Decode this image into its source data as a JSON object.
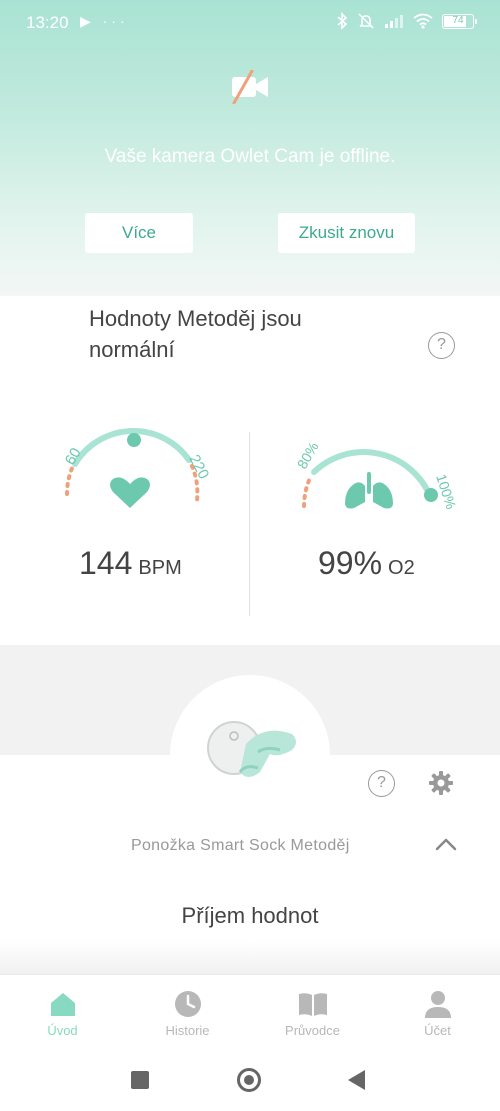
{
  "status_bar": {
    "time": "13:20",
    "left_icons": "▶ ···",
    "battery": "74"
  },
  "camera": {
    "icon": "camera-off-icon",
    "offline_message": "Vaše kamera Owlet Cam je offline.",
    "more_button": "Více",
    "retry_button": "Zkusit znovu"
  },
  "vitals": {
    "title": "Hodnoty Metoděj jsou normální",
    "heart": {
      "value": "144",
      "unit": "BPM",
      "min_label": "60",
      "max_label": "220",
      "min": 60,
      "max": 220,
      "current": 144,
      "icon": "heart-icon"
    },
    "oxygen": {
      "value": "99%",
      "unit": "O2",
      "min_label": "80%",
      "max_label": "100%",
      "min": 80,
      "max": 100,
      "current": 99,
      "icon": "lungs-icon"
    }
  },
  "sock": {
    "name": "Ponožka Smart Sock Metoděj",
    "status": "Příjem hodnot"
  },
  "nav": {
    "items": [
      {
        "label": "Úvod",
        "icon": "home-icon",
        "active": true
      },
      {
        "label": "Historie",
        "icon": "clock-icon",
        "active": false
      },
      {
        "label": "Průvodce",
        "icon": "book-icon",
        "active": false
      },
      {
        "label": "Účet",
        "icon": "person-icon",
        "active": false
      }
    ]
  },
  "colors": {
    "accent": "#88d9c2",
    "accent_dark": "#3daa90",
    "warning_dots": "#f0a07a",
    "header_top": "#a9e3d3"
  }
}
